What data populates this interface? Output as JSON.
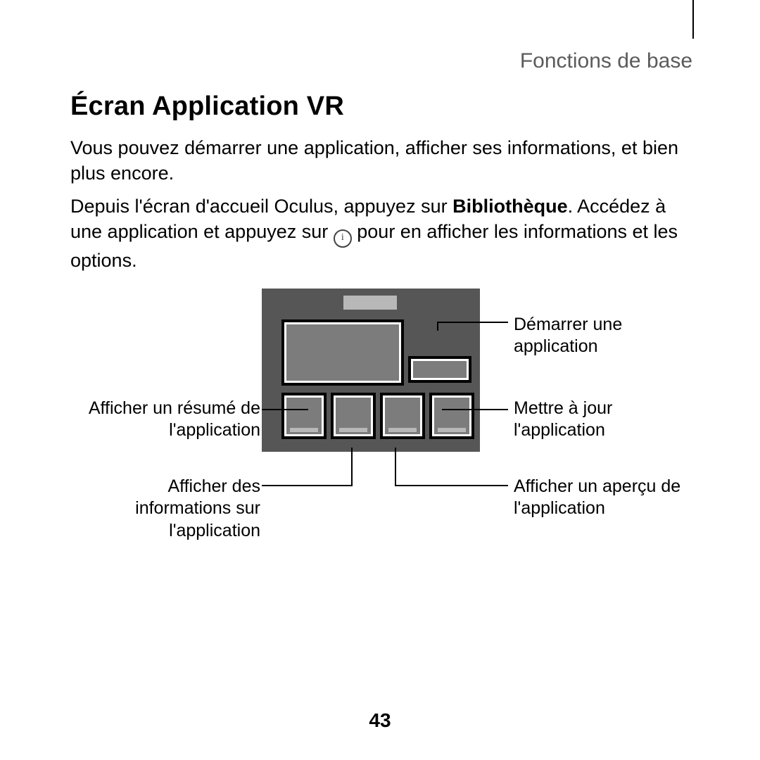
{
  "header": {
    "section": "Fonctions de base"
  },
  "title": "Écran Application VR",
  "para1": "Vous pouvez démarrer une application, afficher ses informations, et bien plus encore.",
  "para2": {
    "pre": "Depuis l'écran d'accueil Oculus, appuyez sur ",
    "bold": "Bibliothèque",
    "mid": ". Accédez à une application et appuyez sur ",
    "icon": "i",
    "post": " pour en afficher les informations et les options."
  },
  "callouts": {
    "start": "Démarrer une application",
    "update": "Mettre à jour l'application",
    "preview": "Afficher un aperçu de l'application",
    "summary": "Afficher un résumé de l'application",
    "info": "Afficher des informations sur l'application"
  },
  "pageNumber": "43"
}
